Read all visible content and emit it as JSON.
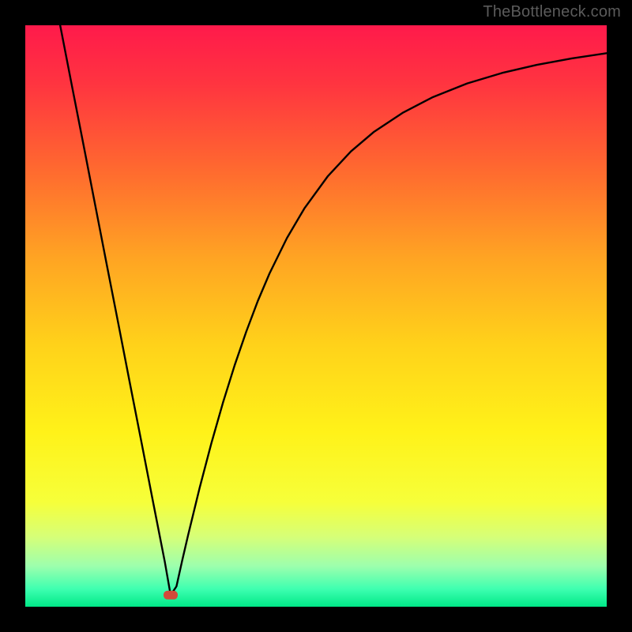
{
  "watermark": "TheBottleneck.com",
  "chart_data": {
    "type": "line",
    "title": "",
    "xlabel": "",
    "ylabel": "",
    "xlim": [
      0,
      100
    ],
    "ylim": [
      0,
      100
    ],
    "background_gradient": {
      "stops": [
        {
          "offset": 0.0,
          "color": "#ff1a4b"
        },
        {
          "offset": 0.1,
          "color": "#ff3440"
        },
        {
          "offset": 0.25,
          "color": "#ff6a2f"
        },
        {
          "offset": 0.4,
          "color": "#ffa423"
        },
        {
          "offset": 0.55,
          "color": "#ffd21a"
        },
        {
          "offset": 0.7,
          "color": "#fff219"
        },
        {
          "offset": 0.82,
          "color": "#f6ff3a"
        },
        {
          "offset": 0.88,
          "color": "#d6ff78"
        },
        {
          "offset": 0.93,
          "color": "#9dffad"
        },
        {
          "offset": 0.97,
          "color": "#3dffb0"
        },
        {
          "offset": 1.0,
          "color": "#00e887"
        }
      ]
    },
    "marker": {
      "x": 25,
      "y": 2,
      "color": "#d24a3a"
    },
    "series": [
      {
        "name": "curve",
        "x": [
          6,
          8,
          10,
          12,
          14,
          16,
          18,
          20,
          22,
          23,
          24,
          25,
          26,
          27,
          28,
          30,
          32,
          34,
          36,
          38,
          40,
          42,
          45,
          48,
          52,
          56,
          60,
          65,
          70,
          76,
          82,
          88,
          94,
          100
        ],
        "y": [
          100,
          89.7,
          79.5,
          69.2,
          58.9,
          48.7,
          38.4,
          28.2,
          17.9,
          12.8,
          7.7,
          2,
          3.5,
          8,
          12.3,
          20.5,
          28.1,
          35.1,
          41.5,
          47.3,
          52.6,
          57.3,
          63.4,
          68.5,
          74.0,
          78.3,
          81.7,
          85.0,
          87.6,
          90.0,
          91.8,
          93.2,
          94.3,
          95.2
        ]
      }
    ]
  }
}
